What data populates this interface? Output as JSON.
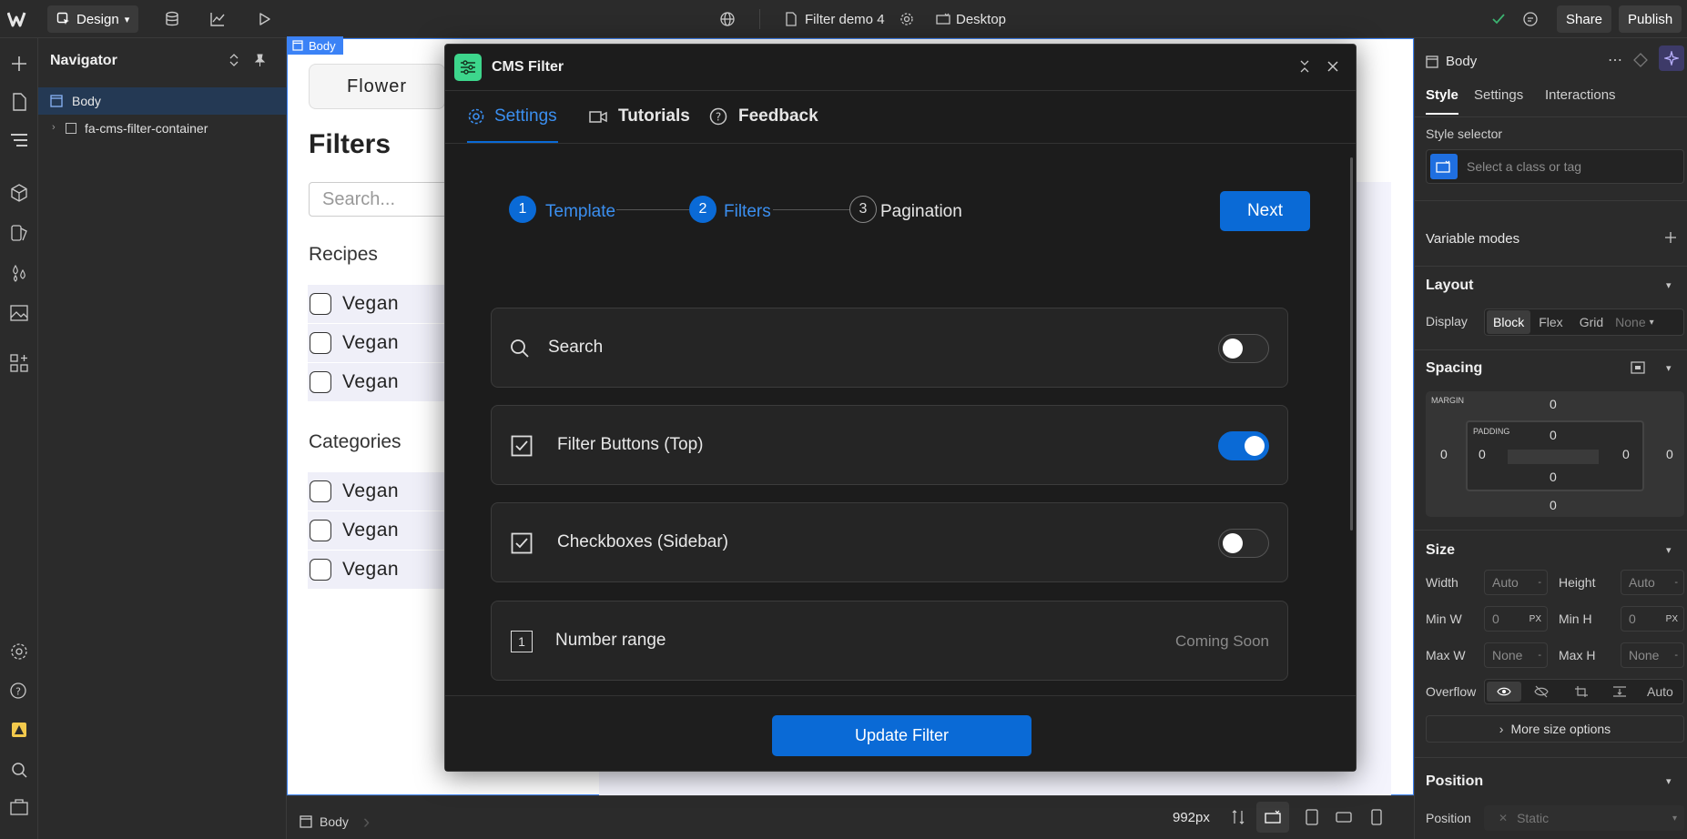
{
  "topbar": {
    "mode_label": "Design",
    "page_name": "Filter demo 4",
    "breakpoint_label": "Desktop",
    "share_label": "Share",
    "publish_label": "Publish"
  },
  "navigator": {
    "title": "Navigator",
    "items": [
      {
        "label": "Body"
      },
      {
        "label": "fa-cms-filter-container"
      }
    ]
  },
  "canvas": {
    "selected_badge": "Body",
    "tab_label": "Flower",
    "heading": "Filters",
    "search_placeholder": "Search...",
    "group1_title": "Recipes",
    "group1_items": [
      "Vegan",
      "Vegan",
      "Vegan"
    ],
    "group2_title": "Categories",
    "group2_items": [
      "Vegan",
      "Vegan",
      "Vegan"
    ]
  },
  "modal": {
    "title": "CMS Filter",
    "tabs": [
      "Settings",
      "Tutorials",
      "Feedback"
    ],
    "steps": [
      {
        "num": "1",
        "label": "Template"
      },
      {
        "num": "2",
        "label": "Filters"
      },
      {
        "num": "3",
        "label": "Pagination"
      }
    ],
    "next_label": "Next",
    "cards": [
      {
        "label": "Search",
        "toggle_on": false
      },
      {
        "label": "Filter Buttons (Top)",
        "toggle_on": true
      },
      {
        "label": "Checkboxes (Sidebar)",
        "toggle_on": false
      },
      {
        "label": "Number range",
        "status": "Coming Soon",
        "icon_num": "1"
      }
    ],
    "update_label": "Update Filter",
    "accent": "#0a6ad6"
  },
  "right_panel": {
    "element_name": "Body",
    "tabs": [
      "Style",
      "Settings",
      "Interactions"
    ],
    "style_selector_label": "Style selector",
    "style_selector_placeholder": "Select a class or tag",
    "variable_modes_label": "Variable modes",
    "layout_title": "Layout",
    "display_label": "Display",
    "display_options": [
      "Block",
      "Flex",
      "Grid",
      "None"
    ],
    "spacing_title": "Spacing",
    "margin_label": "MARGIN",
    "padding_label": "PADDING",
    "margin_values": {
      "top": "0",
      "right": "0",
      "bottom": "0",
      "left": "0"
    },
    "padding_values": {
      "top": "0",
      "right": "0",
      "bottom": "0",
      "left": "0"
    },
    "size_title": "Size",
    "width_label": "Width",
    "width_value": "Auto",
    "height_label": "Height",
    "height_value": "Auto",
    "min_w_label": "Min W",
    "min_w_value": "0",
    "min_h_label": "Min H",
    "min_h_value": "0",
    "max_w_label": "Max W",
    "max_w_value": "None",
    "max_h_label": "Max H",
    "max_h_value": "None",
    "unit_px": "PX",
    "unit_dash": "-",
    "overflow_label": "Overflow",
    "overflow_auto": "Auto",
    "more_size_label": "More size options",
    "position_title": "Position",
    "position_label": "Position",
    "position_value": "Static"
  },
  "bottombar": {
    "breadcrumb": "Body",
    "width_readout": "992px"
  }
}
